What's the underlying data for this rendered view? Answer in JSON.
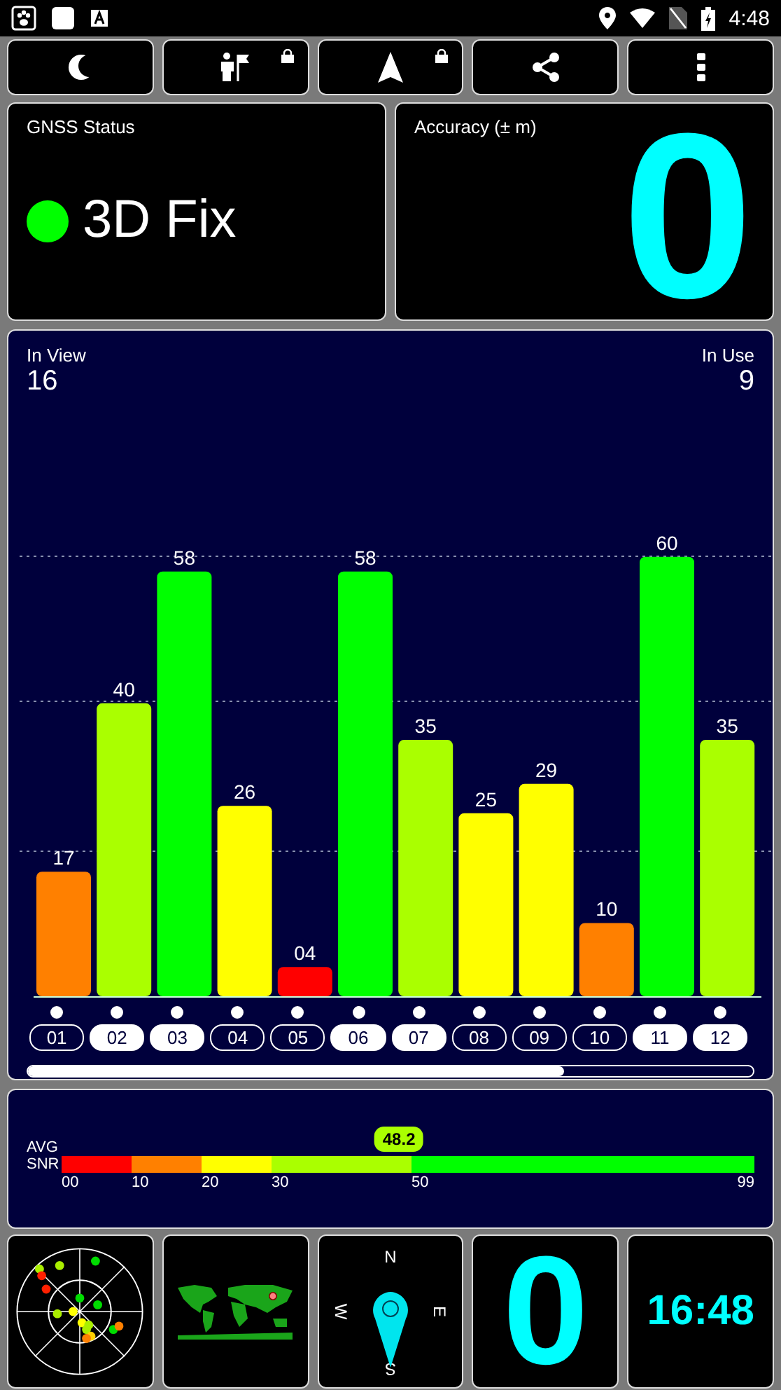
{
  "status_bar": {
    "time": "4:48"
  },
  "toolbar": [
    {
      "kind": "night",
      "locked": false
    },
    {
      "kind": "waypoint",
      "locked": true
    },
    {
      "kind": "navigate",
      "locked": true
    },
    {
      "kind": "share",
      "locked": false
    },
    {
      "kind": "menu",
      "locked": false
    }
  ],
  "gnss_status": {
    "title": "GNSS Status",
    "fix": "3D Fix",
    "fix_ok": true
  },
  "accuracy": {
    "title": "Accuracy (± m)",
    "value": "0"
  },
  "satellites": {
    "in_view_label": "In View",
    "in_view": "16",
    "in_use_label": "In Use",
    "in_use": "9",
    "bars": [
      {
        "id": "01",
        "snr": "17",
        "color": "#ff8000",
        "in_use": false
      },
      {
        "id": "02",
        "snr": "40",
        "color": "#aaff00",
        "in_use": true
      },
      {
        "id": "03",
        "snr": "58",
        "color": "#00ff00",
        "in_use": true
      },
      {
        "id": "04",
        "snr": "26",
        "color": "#ffff00",
        "in_use": false
      },
      {
        "id": "05",
        "snr": "04",
        "color": "#ff0000",
        "in_use": false
      },
      {
        "id": "06",
        "snr": "58",
        "color": "#00ff00",
        "in_use": true
      },
      {
        "id": "07",
        "snr": "35",
        "color": "#aaff00",
        "in_use": true
      },
      {
        "id": "08",
        "snr": "25",
        "color": "#ffff00",
        "in_use": false
      },
      {
        "id": "09",
        "snr": "29",
        "color": "#ffff00",
        "in_use": false
      },
      {
        "id": "10",
        "snr": "10",
        "color": "#ff8000",
        "in_use": false
      },
      {
        "id": "11",
        "snr": "60",
        "color": "#00ff00",
        "in_use": true
      },
      {
        "id": "12",
        "snr": "35",
        "color": "#aaff00",
        "in_use": true
      }
    ]
  },
  "snr": {
    "label_top": "AVG",
    "label_bottom": "SNR",
    "average": "48.2",
    "level": 0.487,
    "segments": [
      {
        "tick": "00",
        "color": "#ff0000"
      },
      {
        "tick": "10",
        "color": "#ff8000"
      },
      {
        "tick": "20",
        "color": "#ffff00"
      },
      {
        "tick": "30",
        "color": "#aaff00"
      },
      {
        "tick": "50",
        "color": "#00ff00"
      }
    ],
    "end_tick": "99"
  },
  "tiles": [
    {
      "kind": "radar"
    },
    {
      "kind": "map"
    },
    {
      "kind": "compass",
      "north": "N",
      "east": "E",
      "south": "S",
      "west": "W"
    },
    {
      "kind": "accuracy",
      "value": "0"
    },
    {
      "kind": "clock",
      "time": "16:48"
    }
  ]
}
